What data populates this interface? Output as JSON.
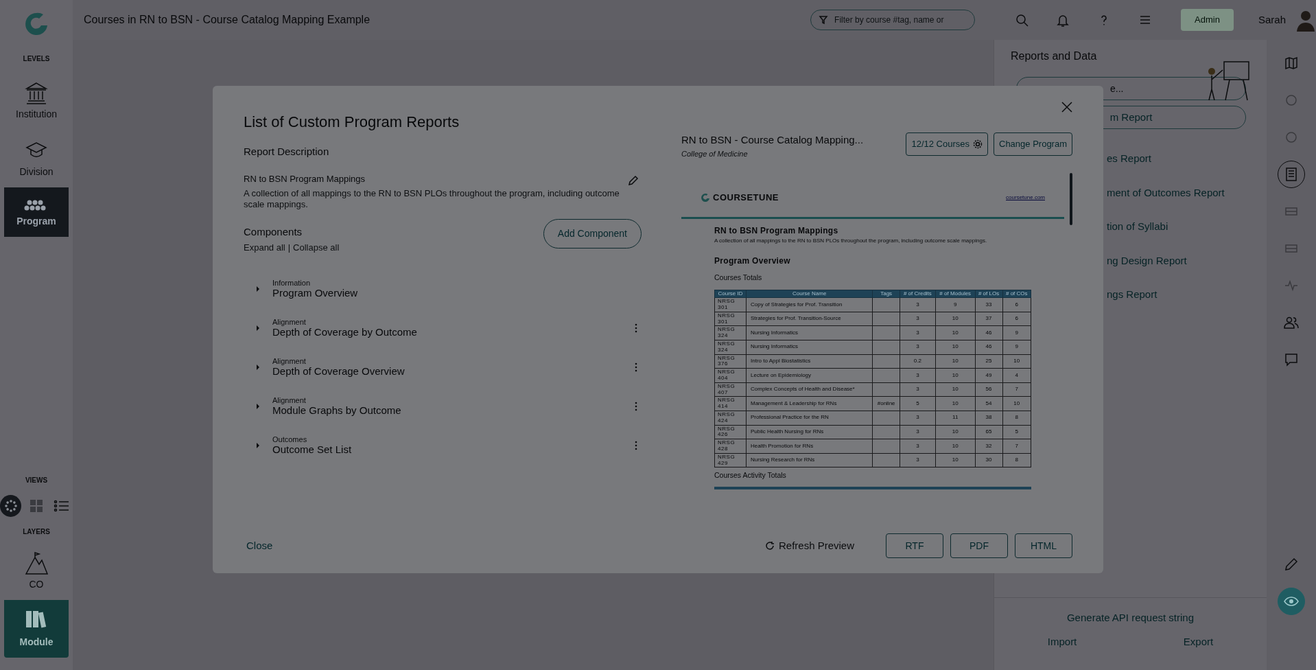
{
  "sidebar": {
    "levels_label": "LEVELS",
    "levels": [
      {
        "label": "Institution",
        "selected": false
      },
      {
        "label": "Division",
        "selected": false
      },
      {
        "label": "Program",
        "selected": true
      }
    ],
    "views_label": "VIEWS",
    "views": [
      {
        "selected": true
      },
      {
        "selected": false
      },
      {
        "selected": false
      }
    ],
    "layers_label": "LAYERS",
    "layers": [
      {
        "label": "CO",
        "selected": false
      },
      {
        "label": "Module",
        "selected": true
      }
    ]
  },
  "topbar": {
    "title": "Courses in RN to BSN - Course Catalog Mapping Example",
    "filter": {
      "placeholder": "Filter by course #tag, name or"
    },
    "admin": "Admin",
    "user": "Sarah"
  },
  "reports_panel": {
    "title": "Reports and Data",
    "search_fragment": "e...",
    "button_fragment": "m Report",
    "items": [
      "es Report",
      "ment of Outcomes Report",
      "tion of Syllabi",
      "ng Design Report",
      "ngs Report"
    ],
    "api": "Generate API request string",
    "import": "Import",
    "export": "Export"
  },
  "rail": [
    {
      "selected": false,
      "disabled": false
    },
    {
      "selected": false,
      "disabled": true
    },
    {
      "selected": false,
      "disabled": true
    },
    {
      "selected": true,
      "disabled": false
    },
    {
      "selected": false,
      "disabled": true
    },
    {
      "selected": false,
      "disabled": true
    },
    {
      "selected": false,
      "disabled": true
    },
    {
      "selected": false,
      "disabled": false
    },
    {
      "selected": false,
      "disabled": false
    },
    {
      "selected": false,
      "disabled": false
    },
    {
      "selected": true,
      "disabled": false
    }
  ],
  "modal": {
    "title": "List of Custom Program Reports",
    "description_heading": "Report Description",
    "report_name": "RN to BSN Program Mappings",
    "report_description": "A collection of all mappings to the RN to BSN PLOs throughout the program, including outcome scale mappings.",
    "components_heading": "Components",
    "expand_all": "Expand all",
    "separator": "|",
    "collapse_all": "Collapse all",
    "add_component": "Add Component",
    "components": [
      {
        "category": "Information",
        "name": "Program Overview",
        "has_menu": false
      },
      {
        "category": "Alignment",
        "name": "Depth of Coverage by Outcome",
        "has_menu": true
      },
      {
        "category": "Alignment",
        "name": "Depth of Coverage Overview",
        "has_menu": true
      },
      {
        "category": "Alignment",
        "name": "Module Graphs by Outcome",
        "has_menu": true
      },
      {
        "category": "Outcomes",
        "name": "Outcome Set List",
        "has_menu": true
      }
    ],
    "program_title": "RN to BSN - Course Catalog Mapping...",
    "program_college": "College of Medicine",
    "courses_button": "12/12 Courses",
    "change_program": "Change Program",
    "preview": {
      "brand": "COURSETUNE",
      "link": "coursetune.com",
      "heading": "RN to BSN Program Mappings",
      "description": "A collection of all mappings to the RN to BSN PLOs throughout the program, including outcome scale mappings.",
      "section": "Program Overview",
      "table_title": "Courses Totals",
      "columns": [
        "Course ID",
        "Course Name",
        "Tags",
        "# of Credits",
        "# of Modules",
        "# of LOs",
        "# of COs"
      ],
      "rows": [
        [
          "NRSG 301",
          "Copy of Strategies for Prof. Transition",
          "",
          "3",
          "9",
          "33",
          "6"
        ],
        [
          "NRSG 301",
          "Strategies for Prof. Transition-Source",
          "",
          "3",
          "10",
          "37",
          "6"
        ],
        [
          "NRSG 324",
          "Nursing Informatics",
          "",
          "3",
          "10",
          "46",
          "9"
        ],
        [
          "NRSG 324",
          "Nursing Informatics",
          "",
          "3",
          "10",
          "46",
          "9"
        ],
        [
          "NRSG 376",
          "Intro to Appl Biostatistics",
          "",
          "0.2",
          "10",
          "25",
          "10"
        ],
        [
          "NRSG 404",
          "Lecture on Epidemiology",
          "",
          "3",
          "10",
          "49",
          "4"
        ],
        [
          "NRSG 407",
          "Complex Concepts of Health and Disease*",
          "",
          "3",
          "10",
          "56",
          "7"
        ],
        [
          "NRSG 414",
          "Management & Leadership for RNs",
          "#online",
          "5",
          "10",
          "54",
          "10"
        ],
        [
          "NRSG 424",
          "Professional Practice for the RN",
          "",
          "3",
          "11",
          "38",
          "8"
        ],
        [
          "NRSG 426",
          "Public Health Nursing for RNs",
          "",
          "3",
          "10",
          "65",
          "5"
        ],
        [
          "NRSG 428",
          "Health Promotion for RNs",
          "",
          "3",
          "10",
          "32",
          "7"
        ],
        [
          "NRSG 429",
          "Nursing Research for RNs",
          "",
          "3",
          "10",
          "30",
          "8"
        ]
      ],
      "second_table_title": "Courses Activity Totals"
    },
    "close": "Close",
    "refresh": "Refresh Preview",
    "formats": [
      "RTF",
      "PDF",
      "HTML"
    ]
  }
}
